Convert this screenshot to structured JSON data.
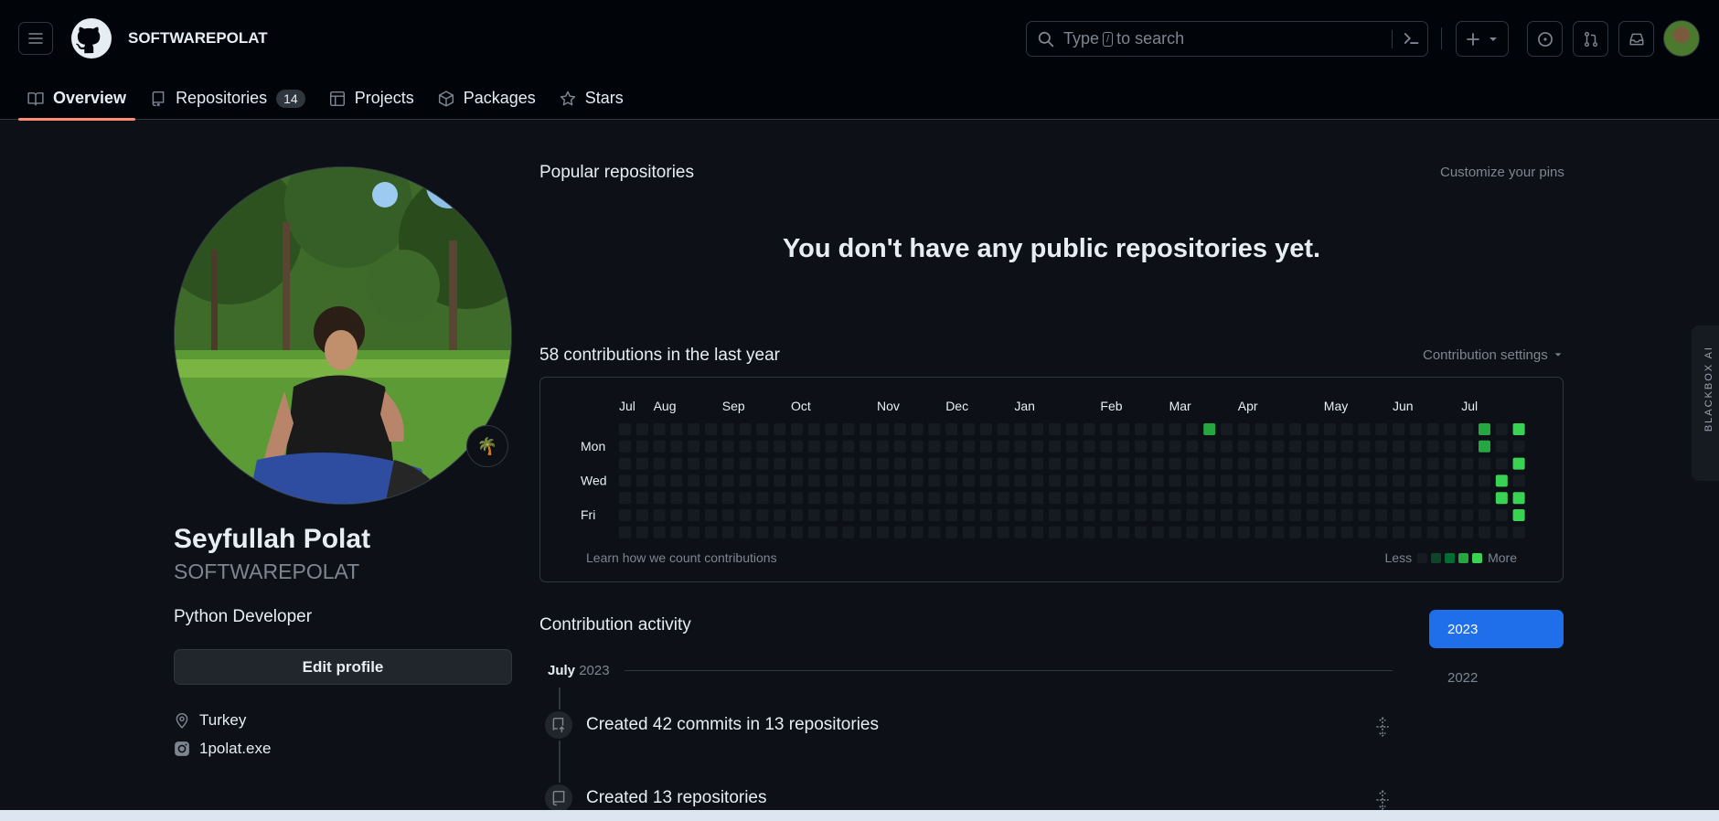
{
  "header": {
    "username": "SOFTWAREPOLAT",
    "search_before": "Type",
    "search_key": "/",
    "search_after": "to search"
  },
  "tabs": [
    {
      "label": "Overview"
    },
    {
      "label": "Repositories",
      "count": "14"
    },
    {
      "label": "Projects"
    },
    {
      "label": "Packages"
    },
    {
      "label": "Stars"
    }
  ],
  "profile": {
    "full_name": "Seyfullah Polat",
    "login": "SOFTWAREPOLAT",
    "bio": "Python Developer",
    "edit_label": "Edit profile",
    "status_emoji": "🌴",
    "location": "Turkey",
    "instagram": "1polat.exe"
  },
  "popular": {
    "title": "Popular repositories",
    "customize": "Customize your pins",
    "empty": "You don't have any public repositories yet."
  },
  "contributions": {
    "title": "58 contributions in the last year",
    "settings": "Contribution settings",
    "learn": "Learn how we count contributions",
    "less": "Less",
    "more": "More",
    "months": [
      "Jul",
      "Aug",
      "Sep",
      "Oct",
      "Nov",
      "Dec",
      "Jan",
      "Feb",
      "Mar",
      "Apr",
      "May",
      "Jun",
      "Jul"
    ],
    "days": [
      "Mon",
      "Wed",
      "Fri"
    ],
    "colors": {
      "empty": "#161b22",
      "l1": "#0e4429",
      "l2": "#006d32",
      "l3": "#26a641",
      "l4": "#39d353"
    },
    "active_cells": [
      {
        "week": 34,
        "day": 0,
        "level": 3
      },
      {
        "week": 50,
        "day": 0,
        "level": 3
      },
      {
        "week": 50,
        "day": 1,
        "level": 3
      },
      {
        "week": 51,
        "day": 3,
        "level": 4
      },
      {
        "week": 51,
        "day": 4,
        "level": 4
      },
      {
        "week": 52,
        "day": 0,
        "level": 4
      },
      {
        "week": 52,
        "day": 2,
        "level": 4
      },
      {
        "week": 52,
        "day": 4,
        "level": 4
      },
      {
        "week": 52,
        "day": 5,
        "level": 4
      }
    ]
  },
  "activity": {
    "title": "Contribution activity",
    "years": [
      "2023",
      "2022"
    ],
    "month": "July",
    "month_year": "2023",
    "items": [
      {
        "text": "Created 42 commits in 13 repositories"
      },
      {
        "text": "Created 13 repositories"
      }
    ]
  },
  "sidebar_ext": {
    "label": "BLACKBOX AI"
  }
}
